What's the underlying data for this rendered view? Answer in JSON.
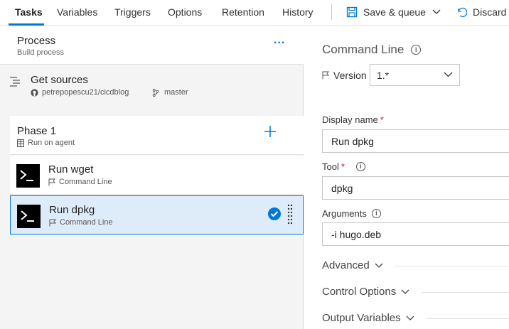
{
  "tabs": [
    {
      "label": "Tasks",
      "active": true
    },
    {
      "label": "Variables",
      "active": false
    },
    {
      "label": "Triggers",
      "active": false
    },
    {
      "label": "Options",
      "active": false
    },
    {
      "label": "Retention",
      "active": false
    },
    {
      "label": "History",
      "active": false
    }
  ],
  "toolbar": {
    "save_label": "Save & queue",
    "discard_label": "Discard"
  },
  "process": {
    "title": "Process",
    "subtitle": "Build process",
    "menu": "..."
  },
  "get_sources": {
    "title": "Get sources",
    "repo": "petrepopescu21/cicdblog",
    "branch": "master"
  },
  "phase": {
    "title": "Phase 1",
    "subtitle": "Run on agent"
  },
  "tasks": [
    {
      "title": "Run wget",
      "subtitle": "Command Line",
      "selected": false
    },
    {
      "title": "Run dpkg",
      "subtitle": "Command Line",
      "selected": true
    }
  ],
  "details": {
    "title": "Command Line",
    "version_label": "Version",
    "version_value": "1.*",
    "display_name_label": "Display name",
    "display_name_value": "Run dpkg",
    "tool_label": "Tool",
    "tool_value": "dpkg",
    "arguments_label": "Arguments",
    "arguments_value": "-i hugo.deb",
    "required_mark": "*",
    "sections": [
      "Advanced",
      "Control Options",
      "Output Variables"
    ]
  },
  "colors": {
    "accent": "#0078d4",
    "selected_bg": "#deecf9",
    "required": "#a4262c"
  }
}
